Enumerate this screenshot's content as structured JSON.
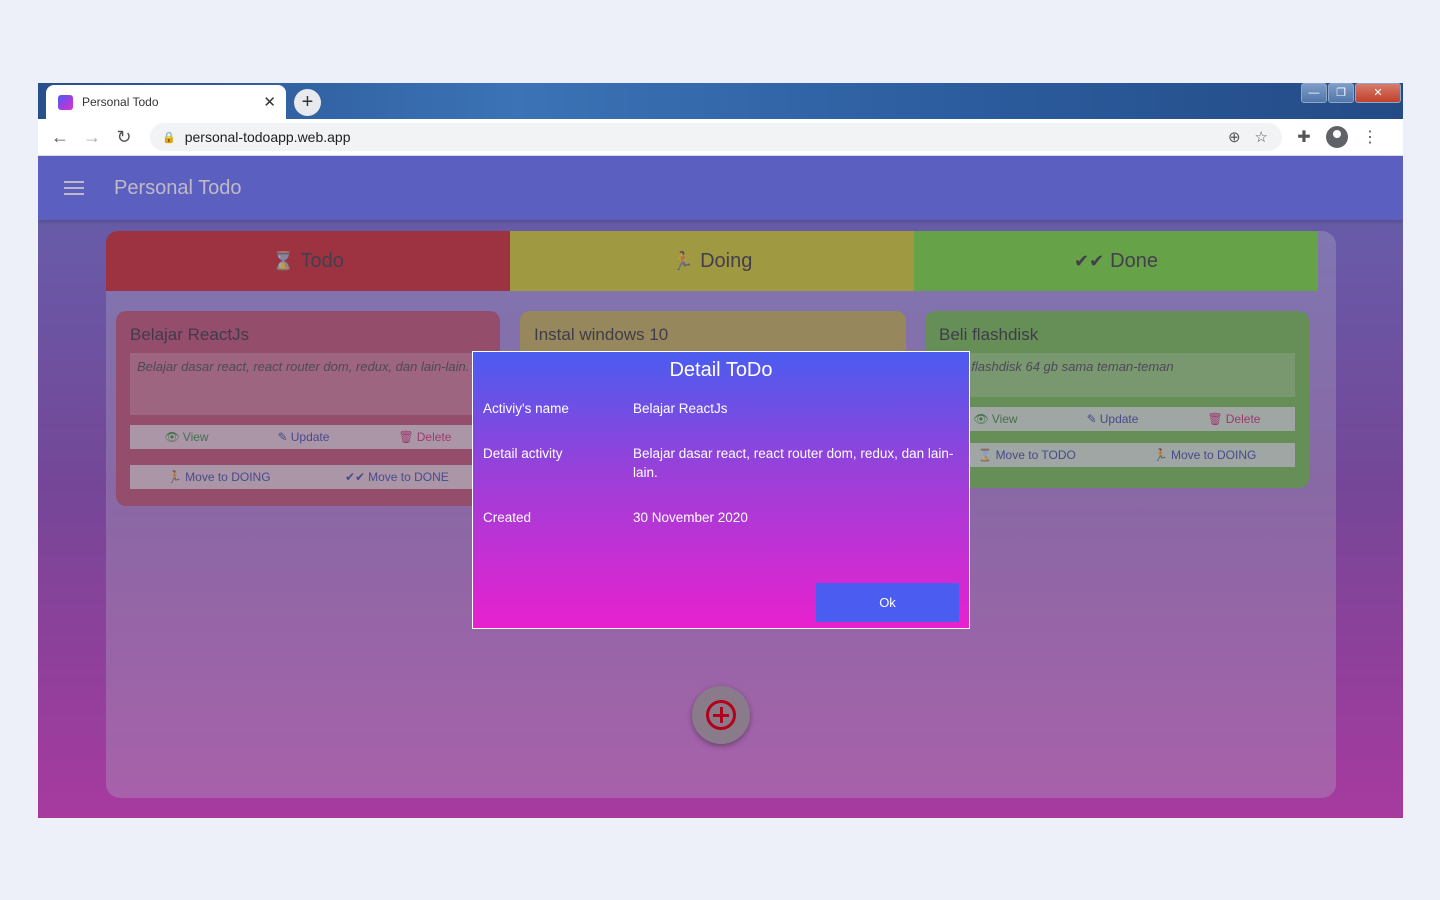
{
  "browser": {
    "tab_title": "Personal Todo",
    "tab_close": "✕",
    "new_tab": "+",
    "url": "personal-todoapp.web.app",
    "win_minimize": "—",
    "win_maximize": "❐",
    "win_close": "✕"
  },
  "app": {
    "title": "Personal Todo"
  },
  "columns": {
    "todo": "Todo",
    "doing": "Doing",
    "done": "Done"
  },
  "cards": {
    "todo": {
      "title": "Belajar ReactJs",
      "description": "Belajar dasar react, react router dom, redux, dan lain-lain.",
      "view": "View",
      "update": "Update",
      "delete": "Delete",
      "move1": "Move to DOING",
      "move2": "Move to DONE"
    },
    "doing": {
      "title": "Instal windows 10"
    },
    "done": {
      "title": "Beli flashdisk",
      "description": "Beli flashdisk 64 gb sama teman-teman",
      "view": "View",
      "update": "Update",
      "delete": "Delete",
      "move1": "Move to TODO",
      "move2": "Move to DOING"
    }
  },
  "modal": {
    "title": "Detail ToDo",
    "name_label": "Activiy's name",
    "name_value": "Belajar ReactJs",
    "detail_label": "Detail activity",
    "detail_value": "Belajar dasar react, react router dom, redux, dan lain-lain.",
    "created_label": "Created",
    "created_value": "30 November 2020",
    "ok_label": "Ok"
  },
  "icons": {
    "todo_column": "hourglass-icon",
    "doing_column": "running-person-icon",
    "done_column": "double-check-icon",
    "add": "add-circle-icon"
  },
  "colors": {
    "appbar": "#4b5cf0",
    "todo": "#c40c0c",
    "doing": "#c7c50d",
    "done": "#60d616",
    "fab_icon": "#b3001b"
  }
}
